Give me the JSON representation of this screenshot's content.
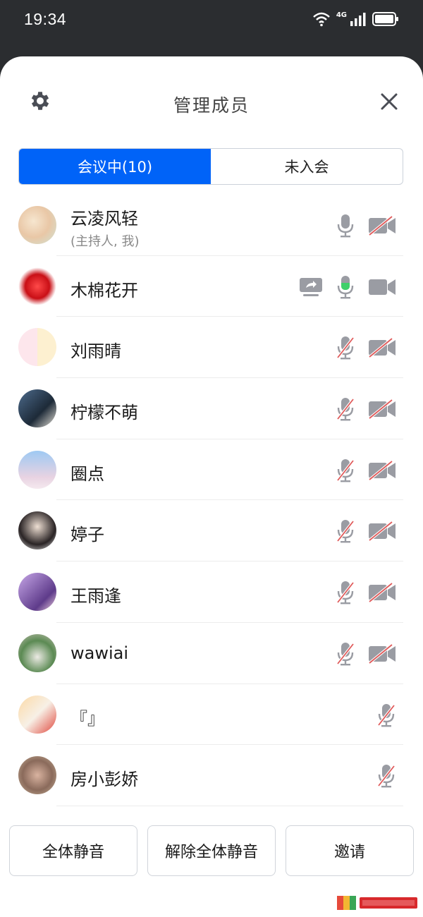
{
  "status_bar": {
    "time": "19:34",
    "network": "4G"
  },
  "header": {
    "title": "管理成员"
  },
  "tabs": [
    {
      "label": "会议中(10)",
      "active": true
    },
    {
      "label": "未入会",
      "active": false
    }
  ],
  "members": [
    {
      "name": "云凌风轻",
      "subtitle": "(主持人, 我)",
      "sharing": false,
      "mic": "on",
      "video": "off"
    },
    {
      "name": "木棉花开",
      "subtitle": "",
      "sharing": true,
      "mic": "speaking",
      "video": "on"
    },
    {
      "name": "刘雨晴",
      "subtitle": "",
      "sharing": false,
      "mic": "muted",
      "video": "off"
    },
    {
      "name": "柠檬不萌",
      "subtitle": "",
      "sharing": false,
      "mic": "muted",
      "video": "off"
    },
    {
      "name": "圈点",
      "subtitle": "",
      "sharing": false,
      "mic": "muted",
      "video": "off"
    },
    {
      "name": "婷子",
      "subtitle": "",
      "sharing": false,
      "mic": "muted",
      "video": "off"
    },
    {
      "name": "王雨逢",
      "subtitle": "",
      "sharing": false,
      "mic": "muted",
      "video": "off"
    },
    {
      "name": "wawiai",
      "subtitle": "",
      "sharing": false,
      "mic": "muted",
      "video": "off"
    },
    {
      "name": "『』",
      "subtitle": "",
      "sharing": false,
      "mic": "muted",
      "video": "none"
    },
    {
      "name": "房小彭娇",
      "subtitle": "",
      "sharing": false,
      "mic": "muted",
      "video": "none"
    }
  ],
  "footer": {
    "mute_all": "全体静音",
    "unmute_all": "解除全体静音",
    "invite": "邀请"
  },
  "colors": {
    "accent": "#0063f8",
    "icon_gray": "#9a9ca3",
    "muted_red": "#e05a5a",
    "speaking_green": "#3fd06a"
  }
}
